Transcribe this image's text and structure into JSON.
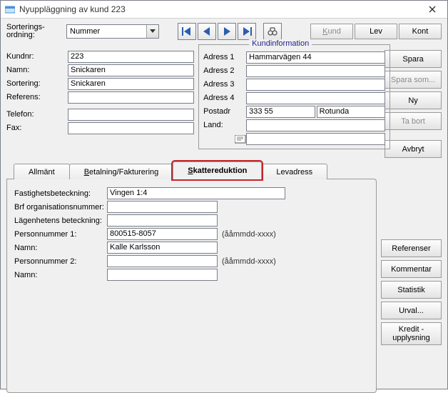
{
  "window": {
    "title": "Nyuppläggning av kund 223"
  },
  "toolbar": {
    "sort_label_line1": "Sorterings-",
    "sort_label_line2": "ordning:",
    "sort_value": "Nummer",
    "btn_kund": "und",
    "btn_kund_ul": "K",
    "btn_lev": "Lev",
    "btn_kont": "Kont"
  },
  "left": {
    "kundnr_lbl": "Kundnr:",
    "kundnr": "223",
    "namn_lbl": "Namn:",
    "namn": "Snickaren",
    "sortering_lbl": "Sortering:",
    "sortering": "Snickaren",
    "referens_lbl": "Referens:",
    "referens": "",
    "telefon_lbl": "Telefon:",
    "telefon": "",
    "fax_lbl": "Fax:",
    "fax": ""
  },
  "mid": {
    "legend": "Kundinformation",
    "adr1_lbl": "Adress 1",
    "adr1": "Hammarvägen 44",
    "adr2_lbl": "Adress 2",
    "adr2": "",
    "adr3_lbl": "Adress 3",
    "adr3": "",
    "adr4_lbl": "Adress 4",
    "adr4": "",
    "post_lbl": "Postadr",
    "post_zip": "333 55",
    "post_city": "Rotunda",
    "land_lbl": "Land:",
    "land": ""
  },
  "rightbtns": {
    "spara": "Spara",
    "spara_ul": "S",
    "spara_som": "Spara som...",
    "ny": "y",
    "ny_ul": "N",
    "tabort": "a bort",
    "tabort_ul": "T",
    "avbryt": "vbryt",
    "avbryt_ul": "A"
  },
  "tabs": {
    "allmant": "Allmänt",
    "betalning_pre": "etalning/Fakturering",
    "betalning_ul": "B",
    "skatt_pre": "kattereduktion",
    "skatt_ul": "S",
    "levadress": "Levadress"
  },
  "skatt": {
    "fastighet_lbl": "Fastighetsbeteckning:",
    "fastighet": "Vingen 1:4",
    "brf_lbl": "Brf organisationsnummer:",
    "brf": "",
    "lagenhet_lbl": "Lägenhetens beteckning:",
    "lagenhet": "",
    "pnr1_lbl": "Personnummer 1:",
    "pnr1": "800515-8057",
    "hint1": "(ååmmdd-xxxx)",
    "namn1_lbl": "Namn:",
    "namn1": "Kalle Karlsson",
    "pnr2_lbl": "Personnummer 2:",
    "pnr2": "",
    "hint2": "(ååmmdd-xxxx)",
    "namn2_lbl": "Namn:",
    "namn2": ""
  },
  "side2": {
    "referenser": "eferenser",
    "referenser_ul": "R",
    "kommentar": "ommentar",
    "kommentar_ul": "K",
    "statistik": "tatistik",
    "statistik_ul": "S",
    "urval": "rval...",
    "urval_ul": "U",
    "kredit_l1": "Kredit -",
    "kredit_l2": "upplysning"
  }
}
